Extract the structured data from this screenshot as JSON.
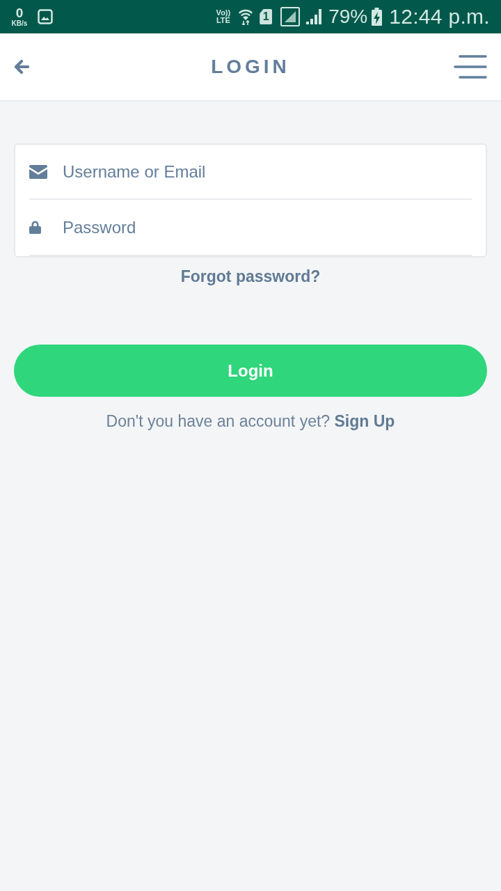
{
  "status_bar": {
    "data_speed": "0",
    "data_unit": "KB/s",
    "volte": "Vo))",
    "network": "LTE",
    "sim": "1",
    "battery": "79%",
    "time": "12:44 p.m."
  },
  "header": {
    "title": "LOGIN"
  },
  "form": {
    "fields": [
      {
        "kind": "email",
        "placeholder": "Username or Email"
      },
      {
        "kind": "password",
        "placeholder": "Password"
      }
    ],
    "forgot_link": "Forgot password?"
  },
  "login_button": "Login",
  "signup": {
    "prompt": "Don't you have an account yet?",
    "link": "Sign Up"
  }
}
